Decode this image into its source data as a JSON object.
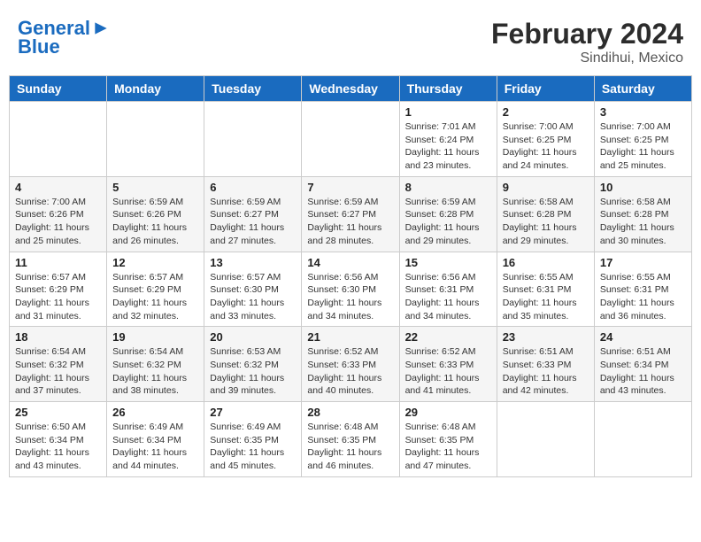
{
  "header": {
    "logo_line1": "General",
    "logo_line2": "Blue",
    "month": "February 2024",
    "location": "Sindihui, Mexico"
  },
  "weekdays": [
    "Sunday",
    "Monday",
    "Tuesday",
    "Wednesday",
    "Thursday",
    "Friday",
    "Saturday"
  ],
  "weeks": [
    [
      {
        "day": "",
        "info": ""
      },
      {
        "day": "",
        "info": ""
      },
      {
        "day": "",
        "info": ""
      },
      {
        "day": "",
        "info": ""
      },
      {
        "day": "1",
        "info": "Sunrise: 7:01 AM\nSunset: 6:24 PM\nDaylight: 11 hours\nand 23 minutes."
      },
      {
        "day": "2",
        "info": "Sunrise: 7:00 AM\nSunset: 6:25 PM\nDaylight: 11 hours\nand 24 minutes."
      },
      {
        "day": "3",
        "info": "Sunrise: 7:00 AM\nSunset: 6:25 PM\nDaylight: 11 hours\nand 25 minutes."
      }
    ],
    [
      {
        "day": "4",
        "info": "Sunrise: 7:00 AM\nSunset: 6:26 PM\nDaylight: 11 hours\nand 25 minutes."
      },
      {
        "day": "5",
        "info": "Sunrise: 6:59 AM\nSunset: 6:26 PM\nDaylight: 11 hours\nand 26 minutes."
      },
      {
        "day": "6",
        "info": "Sunrise: 6:59 AM\nSunset: 6:27 PM\nDaylight: 11 hours\nand 27 minutes."
      },
      {
        "day": "7",
        "info": "Sunrise: 6:59 AM\nSunset: 6:27 PM\nDaylight: 11 hours\nand 28 minutes."
      },
      {
        "day": "8",
        "info": "Sunrise: 6:59 AM\nSunset: 6:28 PM\nDaylight: 11 hours\nand 29 minutes."
      },
      {
        "day": "9",
        "info": "Sunrise: 6:58 AM\nSunset: 6:28 PM\nDaylight: 11 hours\nand 29 minutes."
      },
      {
        "day": "10",
        "info": "Sunrise: 6:58 AM\nSunset: 6:28 PM\nDaylight: 11 hours\nand 30 minutes."
      }
    ],
    [
      {
        "day": "11",
        "info": "Sunrise: 6:57 AM\nSunset: 6:29 PM\nDaylight: 11 hours\nand 31 minutes."
      },
      {
        "day": "12",
        "info": "Sunrise: 6:57 AM\nSunset: 6:29 PM\nDaylight: 11 hours\nand 32 minutes."
      },
      {
        "day": "13",
        "info": "Sunrise: 6:57 AM\nSunset: 6:30 PM\nDaylight: 11 hours\nand 33 minutes."
      },
      {
        "day": "14",
        "info": "Sunrise: 6:56 AM\nSunset: 6:30 PM\nDaylight: 11 hours\nand 34 minutes."
      },
      {
        "day": "15",
        "info": "Sunrise: 6:56 AM\nSunset: 6:31 PM\nDaylight: 11 hours\nand 34 minutes."
      },
      {
        "day": "16",
        "info": "Sunrise: 6:55 AM\nSunset: 6:31 PM\nDaylight: 11 hours\nand 35 minutes."
      },
      {
        "day": "17",
        "info": "Sunrise: 6:55 AM\nSunset: 6:31 PM\nDaylight: 11 hours\nand 36 minutes."
      }
    ],
    [
      {
        "day": "18",
        "info": "Sunrise: 6:54 AM\nSunset: 6:32 PM\nDaylight: 11 hours\nand 37 minutes."
      },
      {
        "day": "19",
        "info": "Sunrise: 6:54 AM\nSunset: 6:32 PM\nDaylight: 11 hours\nand 38 minutes."
      },
      {
        "day": "20",
        "info": "Sunrise: 6:53 AM\nSunset: 6:32 PM\nDaylight: 11 hours\nand 39 minutes."
      },
      {
        "day": "21",
        "info": "Sunrise: 6:52 AM\nSunset: 6:33 PM\nDaylight: 11 hours\nand 40 minutes."
      },
      {
        "day": "22",
        "info": "Sunrise: 6:52 AM\nSunset: 6:33 PM\nDaylight: 11 hours\nand 41 minutes."
      },
      {
        "day": "23",
        "info": "Sunrise: 6:51 AM\nSunset: 6:33 PM\nDaylight: 11 hours\nand 42 minutes."
      },
      {
        "day": "24",
        "info": "Sunrise: 6:51 AM\nSunset: 6:34 PM\nDaylight: 11 hours\nand 43 minutes."
      }
    ],
    [
      {
        "day": "25",
        "info": "Sunrise: 6:50 AM\nSunset: 6:34 PM\nDaylight: 11 hours\nand 43 minutes."
      },
      {
        "day": "26",
        "info": "Sunrise: 6:49 AM\nSunset: 6:34 PM\nDaylight: 11 hours\nand 44 minutes."
      },
      {
        "day": "27",
        "info": "Sunrise: 6:49 AM\nSunset: 6:35 PM\nDaylight: 11 hours\nand 45 minutes."
      },
      {
        "day": "28",
        "info": "Sunrise: 6:48 AM\nSunset: 6:35 PM\nDaylight: 11 hours\nand 46 minutes."
      },
      {
        "day": "29",
        "info": "Sunrise: 6:48 AM\nSunset: 6:35 PM\nDaylight: 11 hours\nand 47 minutes."
      },
      {
        "day": "",
        "info": ""
      },
      {
        "day": "",
        "info": ""
      }
    ]
  ]
}
